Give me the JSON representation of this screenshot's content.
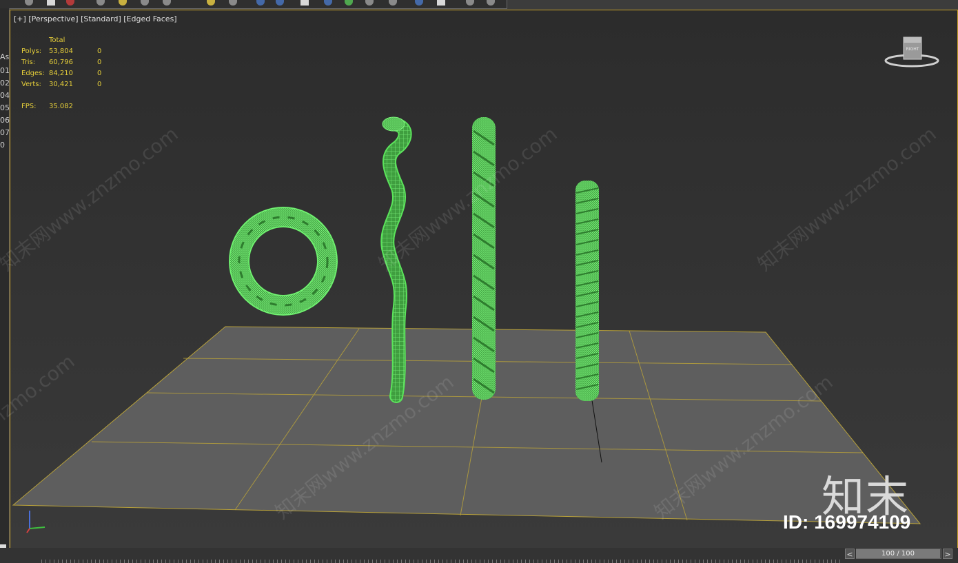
{
  "viewport": {
    "label_plus": "[+]",
    "label_view": "[Perspective]",
    "label_shading": "[Standard]",
    "label_edged": "[Edged Faces]"
  },
  "stats": {
    "header": "Total",
    "rows": [
      {
        "label": "Polys:",
        "total": "53,804",
        "sel": "0"
      },
      {
        "label": "Tris:",
        "total": "60,796",
        "sel": "0"
      },
      {
        "label": "Edges:",
        "total": "84,210",
        "sel": "0"
      },
      {
        "label": "Verts:",
        "total": "30,421",
        "sel": "0"
      }
    ],
    "fps_label": "FPS:",
    "fps_value": "35.082"
  },
  "left_strip": [
    "As",
    "01",
    "02",
    "04",
    "05",
    "06",
    "07",
    "0"
  ],
  "viewcube_label": "RIGHT",
  "watermark_text": "知末网www.znzmo.com",
  "brand": "知末",
  "image_id": "ID: 169974109",
  "time_slider": {
    "value": "100 / 100",
    "prev": "<",
    "next": ">"
  },
  "colors": {
    "wire_green": "#5be35b",
    "grid_line": "#b8a13a",
    "ground": "#5e5e5e"
  }
}
